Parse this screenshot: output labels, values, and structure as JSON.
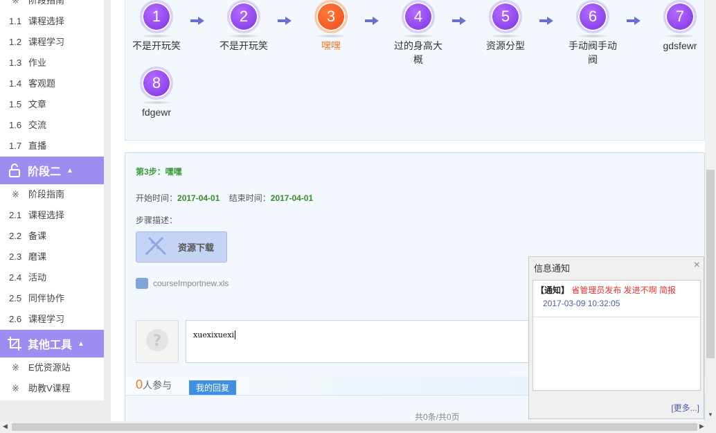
{
  "sidebar": {
    "top_partial": {
      "mark": "※",
      "label": "阶段指南"
    },
    "group1_items": [
      {
        "num": "1.1",
        "label": "课程选择"
      },
      {
        "num": "1.2",
        "label": "课程学习"
      },
      {
        "num": "1.3",
        "label": "作业"
      },
      {
        "num": "1.4",
        "label": "客观题"
      },
      {
        "num": "1.5",
        "label": "文章"
      },
      {
        "num": "1.6",
        "label": "交流"
      },
      {
        "num": "1.7",
        "label": "直播"
      }
    ],
    "stage2_header": "阶段二",
    "stage2_items": [
      {
        "num": "※",
        "label": "阶段指南"
      },
      {
        "num": "2.1",
        "label": "课程选择"
      },
      {
        "num": "2.2",
        "label": "备课"
      },
      {
        "num": "2.3",
        "label": "磨课"
      },
      {
        "num": "2.4",
        "label": "活动"
      },
      {
        "num": "2.5",
        "label": "同伴协作"
      },
      {
        "num": "2.6",
        "label": "课程学习"
      }
    ],
    "tools_header": "其他工具",
    "tools_items": [
      {
        "num": "※",
        "label": "E优资源站"
      },
      {
        "num": "※",
        "label": "助教V课程"
      }
    ],
    "header_color": "#9b8ef0"
  },
  "steps": [
    {
      "num": "1",
      "label": "不是开玩笑"
    },
    {
      "num": "2",
      "label": "不是开玩笑"
    },
    {
      "num": "3",
      "label": "嘿嘿",
      "active": true
    },
    {
      "num": "4",
      "label": "过的身高大概"
    },
    {
      "num": "5",
      "label": "资源分型"
    },
    {
      "num": "6",
      "label": "手动阀手动阀"
    },
    {
      "num": "7",
      "label": "gdsfewr"
    },
    {
      "num": "8",
      "label": "fdgewr"
    }
  ],
  "detail": {
    "title": "第3步：嘿嘿",
    "start_label": "开始时间：",
    "start_value": "2017-04-01",
    "end_label": "结束时间：",
    "end_value": "2017-04-01",
    "desc_label": "步骤描述：",
    "download_label": "资源下载",
    "file_name": "courseImportnew.xls",
    "reply_text": "xuexixuexi",
    "joined_count": "0",
    "joined_label": "人参与",
    "my_reply_label": "我的回复",
    "pager": "共0条/共0页"
  },
  "notice": {
    "title": "信息通知",
    "close": "×",
    "items": [
      {
        "tag": "【通知】",
        "text": " 省管理员发布 发进不啊 简报",
        "date": "2017-03-09 10:32:05"
      }
    ],
    "more": "[更多...]"
  },
  "colors": {
    "accent_purple": "#7a2fe0",
    "active_orange": "#f0451a",
    "step_title_green": "#3a9a3a",
    "notice_red": "#e43232"
  }
}
